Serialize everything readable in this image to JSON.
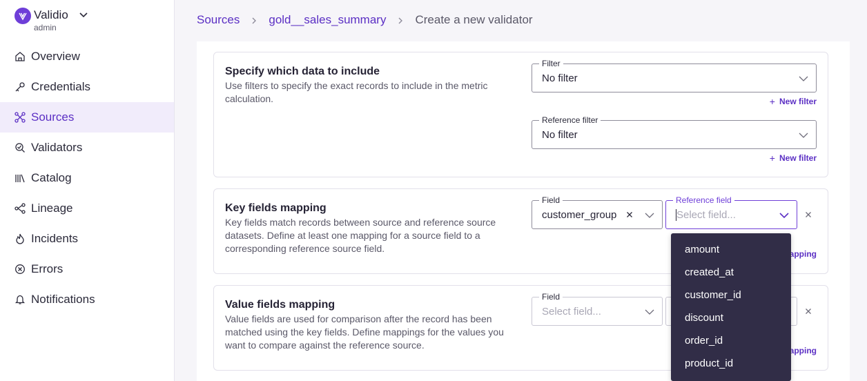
{
  "app": {
    "name": "Validio",
    "workspace": "admin"
  },
  "nav": {
    "items": [
      {
        "label": "Overview",
        "icon": "home-icon"
      },
      {
        "label": "Credentials",
        "icon": "key-icon"
      },
      {
        "label": "Sources",
        "icon": "sources-icon",
        "active": true
      },
      {
        "label": "Validators",
        "icon": "validators-icon"
      },
      {
        "label": "Catalog",
        "icon": "catalog-icon"
      },
      {
        "label": "Lineage",
        "icon": "lineage-icon"
      },
      {
        "label": "Incidents",
        "icon": "flame-icon"
      },
      {
        "label": "Errors",
        "icon": "error-icon"
      },
      {
        "label": "Notifications",
        "icon": "bell-icon"
      }
    ]
  },
  "breadcrumb": {
    "sources": "Sources",
    "dataset": "gold__sales_summary",
    "current": "Create a new validator"
  },
  "include": {
    "title": "Specify which data to include",
    "description": "Use filters to specify the exact records to include in the metric calculation.",
    "filter": {
      "label": "Filter",
      "value": "No filter"
    },
    "new_filter": "New filter",
    "reference_filter": {
      "label": "Reference filter",
      "value": "No filter"
    },
    "new_reference_filter": "New filter"
  },
  "key_mapping": {
    "title": "Key fields mapping",
    "description": "Key fields match records between source and reference source datasets. Define at least one mapping for a source field to a corresponding reference source field.",
    "field": {
      "label": "Field",
      "value": "customer_group"
    },
    "reference_field": {
      "label": "Reference field",
      "placeholder": "Select field..."
    },
    "add_mapping": "apping"
  },
  "value_mapping": {
    "title": "Value fields mapping",
    "description": "Value fields are used for comparison after the record has been matched using the key fields. Define mappings for the values you want to compare against the reference source.",
    "field": {
      "label": "Field",
      "placeholder": "Select field..."
    },
    "add_mapping": "apping"
  },
  "dropdown": {
    "options": [
      "amount",
      "created_at",
      "customer_id",
      "discount",
      "order_id",
      "product_id"
    ]
  },
  "colors": {
    "accent": "#5b2fc4",
    "sidebar_active": "#f1ecfb",
    "dropdown_bg": "#312d47"
  }
}
